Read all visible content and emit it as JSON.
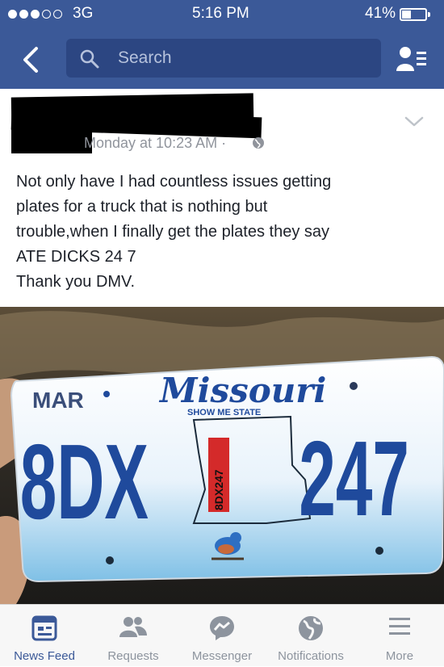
{
  "status_bar": {
    "carrier": "3G",
    "time": "5:16 PM",
    "battery_percent": "41%",
    "battery_level": 0.41,
    "signal_bars_filled": 3,
    "signal_bars_total": 5
  },
  "nav": {
    "search_placeholder": "Search"
  },
  "post": {
    "author_redacted": true,
    "timestamp": "Monday at 10:23 AM ·",
    "lines": [
      "Not only have I had countless issues getting",
      "plates for a truck that is nothing but",
      "trouble,when I finally get the plates they say",
      "ATE DICKS 24 7",
      "Thank you DMV."
    ]
  },
  "photo": {
    "plate": {
      "month": "MAR",
      "state": "Missouri",
      "slogan": "SHOW ME STATE",
      "number_left": "8DX",
      "number_right": "247",
      "sticker_text": "8DX247"
    }
  },
  "tabs": [
    {
      "label": "News Feed",
      "icon": "news-feed-icon",
      "active": true
    },
    {
      "label": "Requests",
      "icon": "friend-requests-icon",
      "active": false
    },
    {
      "label": "Messenger",
      "icon": "messenger-icon",
      "active": false
    },
    {
      "label": "Notifications",
      "icon": "globe-icon",
      "active": false
    },
    {
      "label": "More",
      "icon": "menu-icon",
      "active": false
    }
  ],
  "colors": {
    "brand": "#3b5998",
    "plate_text": "#1f4a9c"
  }
}
